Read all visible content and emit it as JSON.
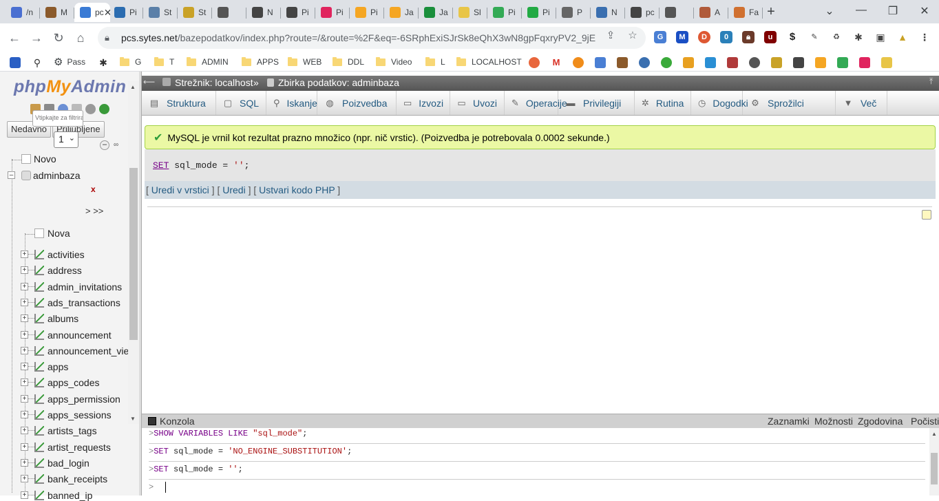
{
  "browser": {
    "tabs": [
      {
        "label": "/n",
        "color": "#4a6fd1"
      },
      {
        "label": "M",
        "color": "#8b5a2b"
      },
      {
        "label": "pc",
        "color": "#3a7bd5",
        "active": true
      },
      {
        "label": "Pi",
        "color": "#2b6cb0"
      },
      {
        "label": "St",
        "color": "#5a7fa8"
      },
      {
        "label": "St",
        "color": "#c9a227"
      },
      {
        "label": "",
        "color": "#555555"
      },
      {
        "label": "N",
        "color": "#444444"
      },
      {
        "label": "Pi",
        "color": "#444444"
      },
      {
        "label": "Pi",
        "color": "#e0245e"
      },
      {
        "label": "Pi",
        "color": "#f5a623"
      },
      {
        "label": "Ja",
        "color": "#f5a623"
      },
      {
        "label": "Ja",
        "color": "#1a8f3c"
      },
      {
        "label": "Sl",
        "color": "#e8c547"
      },
      {
        "label": "Pi",
        "color": "#33aa55"
      },
      {
        "label": "Pi",
        "color": "#22aa44"
      },
      {
        "label": "P",
        "color": "#666666"
      },
      {
        "label": "N",
        "color": "#3a6fb0"
      },
      {
        "label": "pc",
        "color": "#444444"
      },
      {
        "label": "",
        "color": "#555555"
      },
      {
        "label": "A",
        "color": "#b05a3a"
      },
      {
        "label": "Fa",
        "color": "#d07030"
      }
    ],
    "url_host": "pcs.sytes.net",
    "url_path": "/bazepodatkov/index.php?route=/&route=%2F&eq=-6SRphExiSJrSk8eQhX3wN8gpFqxryPV2_9jEl...",
    "bookmarks": [
      {
        "label": "Pass",
        "type": "icon"
      },
      {
        "label": "G",
        "type": "folder"
      },
      {
        "label": "T",
        "type": "folder"
      },
      {
        "label": "ADMIN",
        "type": "folder"
      },
      {
        "label": "APPS",
        "type": "folder"
      },
      {
        "label": "WEB",
        "type": "folder"
      },
      {
        "label": "DDL",
        "type": "folder"
      },
      {
        "label": "Video",
        "type": "folder"
      },
      {
        "label": "L",
        "type": "folder"
      },
      {
        "label": "LOCALHOST",
        "type": "folder"
      }
    ]
  },
  "pma": {
    "logo": {
      "php": "php",
      "my": "My",
      "admin": "Admin"
    },
    "tabs": {
      "recent": "Nedavno",
      "favorites": "Priljubljene"
    },
    "tree": {
      "new_root": "Novo",
      "database": "adminbaza",
      "filter_placeholder": "Vtipkajte za filtriranje",
      "filter_clear": "x",
      "page": "1",
      "page_next": "> >>",
      "new_table": "Nova",
      "tables": [
        "activities",
        "address",
        "admin_invitations",
        "ads_transactions",
        "albums",
        "announcement",
        "announcement_views",
        "apps",
        "apps_codes",
        "apps_permission",
        "apps_sessions",
        "artists_tags",
        "artist_requests",
        "bad_login",
        "bank_receipts",
        "banned_ip"
      ]
    },
    "breadcrumb": {
      "server": "Strežnik: localhost",
      "separator": "»",
      "database": "Zbirka podatkov: adminbaza"
    },
    "menu": [
      {
        "label": "Struktura",
        "icon": "structure-icon"
      },
      {
        "label": "SQL",
        "icon": "sql-icon"
      },
      {
        "label": "Iskanje",
        "icon": "search-icon"
      },
      {
        "label": "Poizvedba",
        "icon": "query-icon"
      },
      {
        "label": "Izvozi",
        "icon": "export-icon"
      },
      {
        "label": "Uvozi",
        "icon": "import-icon"
      },
      {
        "label": "Operacije",
        "icon": "wrench-icon"
      },
      {
        "label": "Privilegiji",
        "icon": "privileges-icon"
      },
      {
        "label": "Rutina",
        "icon": "routine-icon"
      },
      {
        "label": "Dogodki",
        "icon": "events-icon"
      },
      {
        "label": "Sprožilci",
        "icon": "triggers-icon"
      },
      {
        "label": "Več",
        "icon": "chevron-down-icon"
      }
    ],
    "result_message": "MySQL je vrnil kot rezultat prazno množico (npr. nič vrstic). (Poizvedba je potrebovala 0.0002 sekunde.)",
    "query": {
      "kw": "SET",
      "rest": " sql_mode = ",
      "value": "''",
      "end": ";"
    },
    "query_links": {
      "inline_edit": "Uredi v vrstici",
      "edit": "Uredi",
      "create_php": "Ustvari kodo PHP"
    },
    "console": {
      "title": "Konzola",
      "actions": [
        "Zaznamki",
        "Možnosti",
        "Zgodovina",
        "Počisti"
      ],
      "lines": [
        {
          "kw": "SHOW VARIABLES LIKE",
          "rest": " ",
          "value": "\"sql_mode\"",
          "end": ";"
        },
        {
          "kw": "SET",
          "rest": " sql_mode = ",
          "value": "'NO_ENGINE_SUBSTITUTION'",
          "end": ";"
        },
        {
          "kw": "SET",
          "rest": " sql_mode = ",
          "value": "''",
          "end": ";"
        }
      ],
      "prompt": ">"
    }
  }
}
